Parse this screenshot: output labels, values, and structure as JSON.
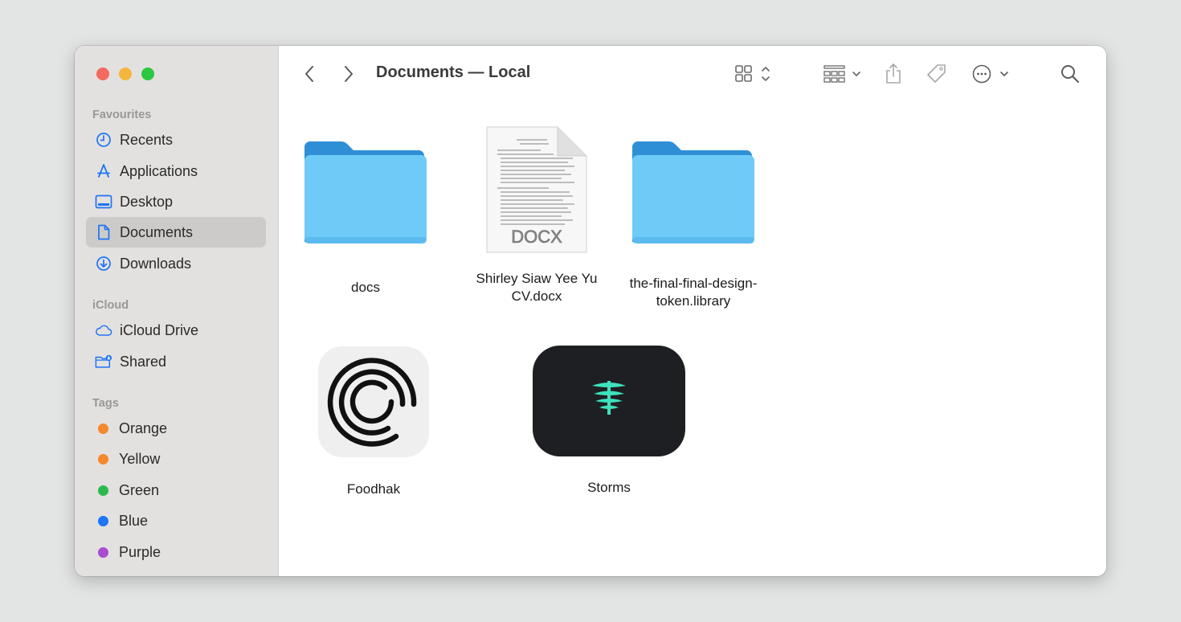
{
  "window": {
    "title": "Documents — Local"
  },
  "sidebar": {
    "favourites_title": "Favourites",
    "favourites": [
      {
        "label": "Recents",
        "icon": "clock-icon"
      },
      {
        "label": "Applications",
        "icon": "applications-icon"
      },
      {
        "label": "Desktop",
        "icon": "desktop-icon"
      },
      {
        "label": "Documents",
        "icon": "document-icon",
        "active": true
      },
      {
        "label": "Downloads",
        "icon": "download-icon"
      }
    ],
    "icloud_title": "iCloud",
    "icloud": [
      {
        "label": "iCloud Drive",
        "icon": "cloud-icon"
      },
      {
        "label": "Shared",
        "icon": "shared-folder-icon"
      }
    ],
    "tags_title": "Tags",
    "tags": [
      {
        "label": "Orange",
        "color": "#f5892e"
      },
      {
        "label": "Yellow",
        "color": "#f5892e"
      },
      {
        "label": "Green",
        "color": "#2db84d"
      },
      {
        "label": "Blue",
        "color": "#1d74f5"
      },
      {
        "label": "Purple",
        "color": "#a74ecf"
      }
    ]
  },
  "files": [
    {
      "name": "docs",
      "kind": "folder"
    },
    {
      "name": "Shirley Siaw Yee Yu CV.docx",
      "name_lines": [
        "Shirley Siaw Yee Yu",
        "CV.docx"
      ],
      "kind": "docx",
      "badge": "DOCX"
    },
    {
      "name": "the-final-final-design-token.library",
      "name_lines": [
        "the-final-final-design-",
        "token.library"
      ],
      "kind": "folder"
    },
    {
      "name": "Foodhak",
      "kind": "app"
    },
    {
      "name": "Storms",
      "kind": "app"
    }
  ],
  "colors": {
    "accent": "#1d74f5",
    "folder_front": "#6ecbf7",
    "folder_back": "#2f8fd6",
    "storms_bg": "#1e1f22",
    "storms_mark": "#3fe0bd"
  }
}
